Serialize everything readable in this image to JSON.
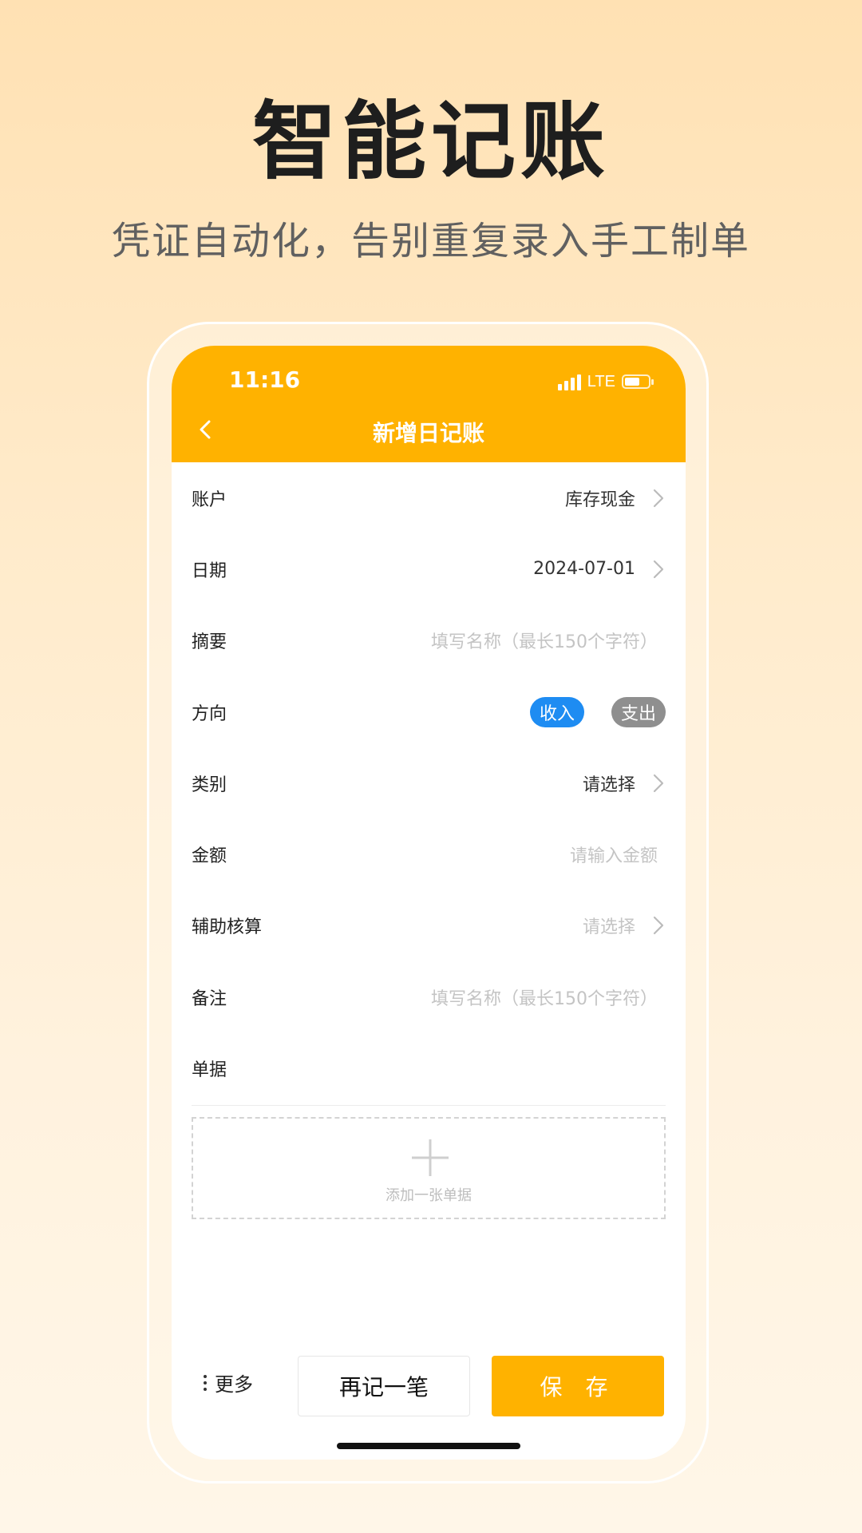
{
  "hero": {
    "title": "智能记账",
    "subtitle": "凭证自动化，告别重复录入手工制单"
  },
  "status_bar": {
    "time": "11:16",
    "network": "LTE"
  },
  "nav": {
    "title": "新增日记账"
  },
  "form": {
    "account": {
      "label": "账户",
      "value": "库存现金"
    },
    "date": {
      "label": "日期",
      "value": "2024-07-01"
    },
    "summary": {
      "label": "摘要",
      "placeholder": "填写名称（最长150个字符）"
    },
    "direction": {
      "label": "方向",
      "options": [
        "收入",
        "支出"
      ],
      "selected": "收入"
    },
    "category": {
      "label": "类别",
      "value": "请选择"
    },
    "amount": {
      "label": "金额",
      "placeholder": "请输入金额"
    },
    "auxiliary": {
      "label": "辅助核算",
      "placeholder": "请选择"
    },
    "remark": {
      "label": "备注",
      "placeholder": "填写名称（最长150个字符）"
    },
    "receipt": {
      "label": "单据",
      "upload_label": "添加一张单据"
    }
  },
  "footer": {
    "more_label": "更多",
    "again_label": "再记一笔",
    "save_label": "保 存"
  },
  "colors": {
    "accent": "#FFB200",
    "toggle_on": "#1E8CF2",
    "toggle_off": "#8F8F8F"
  }
}
